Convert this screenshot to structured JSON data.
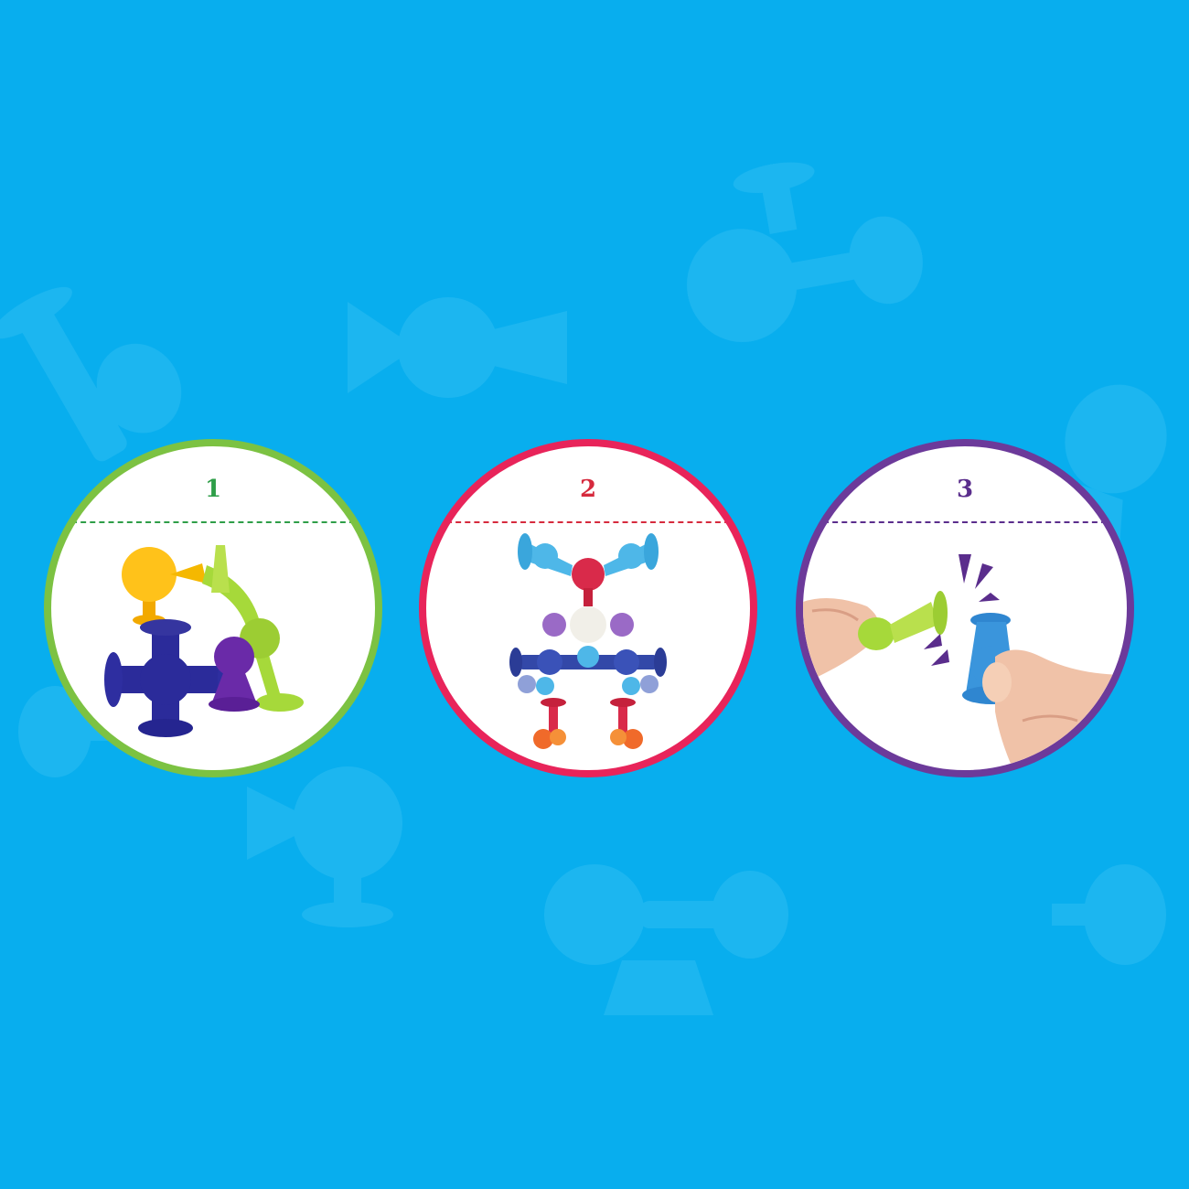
{
  "background_color": "#08aeee",
  "steps": [
    {
      "number": "1",
      "accent_color": "#7cc242",
      "number_color": "#2e9e48",
      "illustration": "suction-toy-cluster-icon"
    },
    {
      "number": "2",
      "accent_color": "#e8245a",
      "number_color": "#d62a3d",
      "illustration": "suction-toy-figure-icon"
    },
    {
      "number": "3",
      "accent_color": "#6c3a9a",
      "number_color": "#5a2d8c",
      "illustration": "hands-connecting-toys-icon"
    }
  ]
}
